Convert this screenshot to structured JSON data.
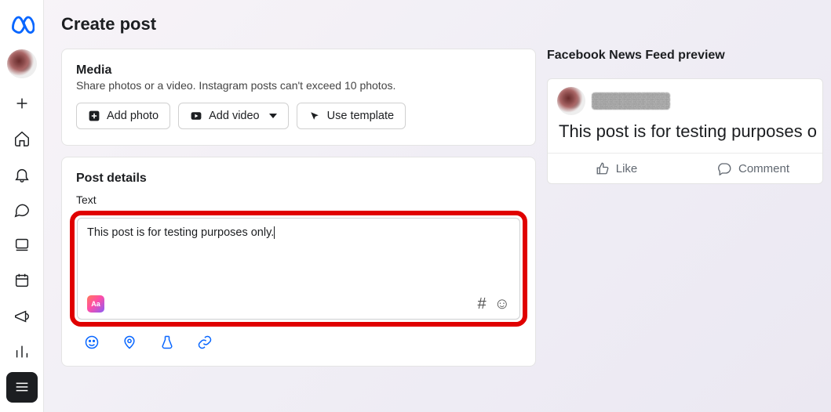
{
  "page": {
    "title": "Create post"
  },
  "media_card": {
    "title": "Media",
    "subtitle": "Share photos or a video. Instagram posts can't exceed 10 photos.",
    "add_photo_label": "Add photo",
    "add_video_label": "Add video",
    "use_template_label": "Use template"
  },
  "post_details": {
    "title": "Post details",
    "text_label": "Text",
    "text_value": "This post is for testing purposes only.",
    "bg_chip_label": "Aa",
    "hashtag_glyph": "#",
    "emoji_glyph": "☺"
  },
  "preview": {
    "title": "Facebook News Feed preview",
    "post_text": "This post is for testing purposes o",
    "like_label": "Like",
    "comment_label": "Comment"
  }
}
